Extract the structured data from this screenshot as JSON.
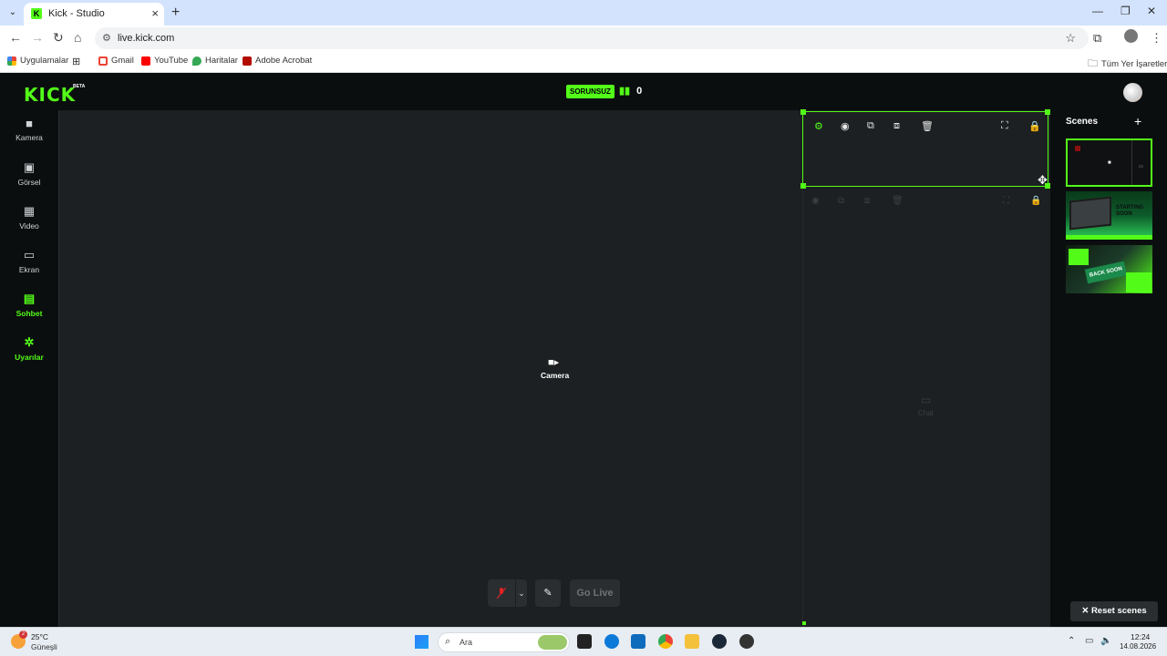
{
  "browser": {
    "tab_title": "Kick - Studio",
    "url": "live.kick.com",
    "bookmarks": [
      {
        "label": "Uygulamalar",
        "icon": "apps-grid-icon"
      },
      {
        "label": "Gmail",
        "icon": "gmail-icon"
      },
      {
        "label": "YouTube",
        "icon": "youtube-icon"
      },
      {
        "label": "Haritalar",
        "icon": "maps-icon"
      },
      {
        "label": "Adobe Acrobat",
        "icon": "acrobat-icon"
      }
    ],
    "all_bookmarks": "Tüm Yer İşaretleri"
  },
  "header": {
    "logo": "KICK",
    "beta": "BETA",
    "status": "SORUNSUZ",
    "viewer_count": "0"
  },
  "sidebar": {
    "items": [
      {
        "label": "Kamera",
        "icon": "camera-icon"
      },
      {
        "label": "Görsel",
        "icon": "image-icon"
      },
      {
        "label": "Video",
        "icon": "film-icon"
      },
      {
        "label": "Ekran",
        "icon": "screen-icon"
      },
      {
        "label": "Sohbet",
        "icon": "chat-icon"
      },
      {
        "label": "Uyarılar",
        "icon": "alerts-icon"
      }
    ]
  },
  "canvas": {
    "camera_label": "Camera",
    "chat_ghost_label": "Chat"
  },
  "controls": {
    "go_live": "Go Live"
  },
  "scenes": {
    "title": "Scenes",
    "thumb2_text": "STARTING SOON",
    "thumb3_text": "BACK SOON",
    "reset_label": "Reset scenes"
  },
  "taskbar": {
    "temp": "25°C",
    "weather": "Güneşli",
    "weather_badge": "2",
    "search_placeholder": "Ara",
    "time": "12:24",
    "date": "14.08.2026"
  },
  "colors": {
    "accent": "#53fc18",
    "canvas": "#1d2022",
    "background": "#0b0e0f"
  }
}
